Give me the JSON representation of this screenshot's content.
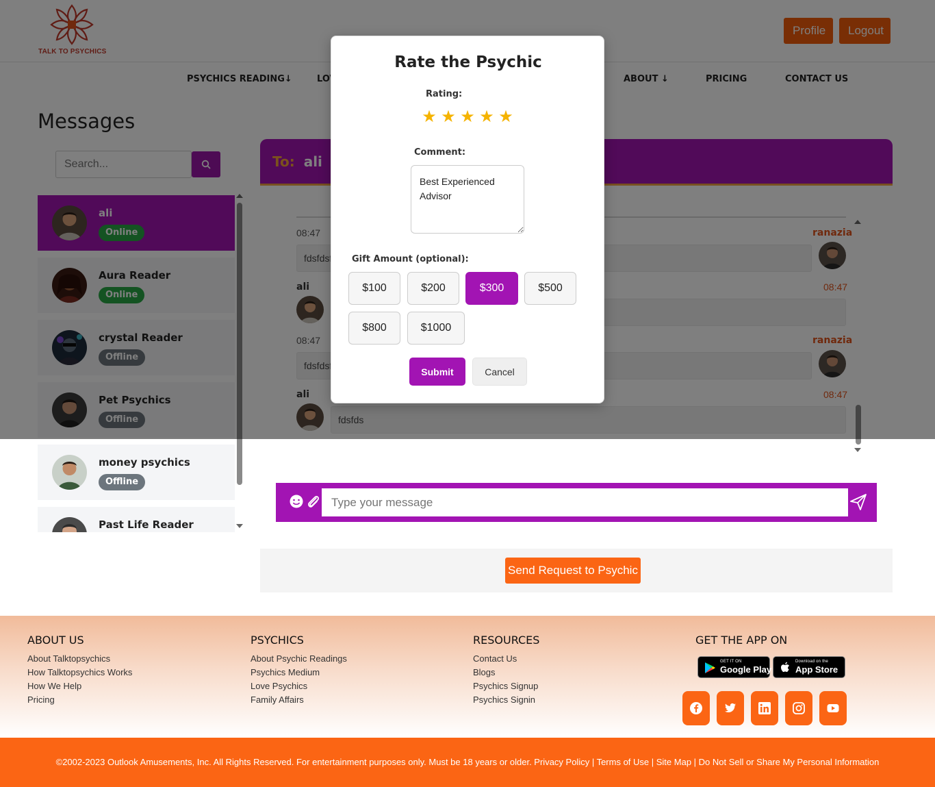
{
  "header": {
    "logo_text": "TALK TO PSYCHICS",
    "profile_label": "Profile",
    "logout_label": "Logout"
  },
  "nav": {
    "psychics_reading": "PSYCHICS READING↓",
    "love": "LOV",
    "about": "ABOUT ↓",
    "pricing": "PRICING",
    "contact": "CONTACT US"
  },
  "page": {
    "title": "Messages"
  },
  "search": {
    "placeholder": "Search..."
  },
  "contacts": [
    {
      "name": "ali",
      "status": "Online"
    },
    {
      "name": "Aura Reader",
      "status": "Online"
    },
    {
      "name": "crystal Reader",
      "status": "Offline"
    },
    {
      "name": "Pet Psychics",
      "status": "Offline"
    },
    {
      "name": "money psychics",
      "status": "Offline"
    },
    {
      "name": "Past Life Reader",
      "status": ""
    }
  ],
  "chat": {
    "to_label": "To:",
    "to_name": "ali",
    "messages": [
      {
        "time": "08:47",
        "sender": "ranazia",
        "text": "fdsfdsf"
      },
      {
        "time": "08:47",
        "sender": "ali",
        "text": ""
      },
      {
        "time": "08:47",
        "sender": "ranazia",
        "text": "fdsfdsf"
      },
      {
        "time": "08:47",
        "sender": "ali",
        "text": "fdsfds"
      }
    ],
    "compose_placeholder": "Type your message",
    "request_label": "Send Request to Psychic"
  },
  "modal": {
    "title": "Rate the Psychic",
    "rating_label": "Rating:",
    "rating_value": 5,
    "star_glyph": "★",
    "comment_label": "Comment:",
    "comment_value": "Best Experienced Advisor",
    "gift_label": "Gift Amount (optional):",
    "gift_options": [
      "$100",
      "$200",
      "$300",
      "$500",
      "$800",
      "$1000"
    ],
    "gift_selected": "$300",
    "submit_label": "Submit",
    "cancel_label": "Cancel"
  },
  "footer": {
    "about": {
      "heading": "ABOUT US",
      "links": [
        "About Talktopsychics",
        "How Talktopsychics Works",
        "How We Help",
        "Pricing"
      ]
    },
    "psychics": {
      "heading": "PSYCHICS",
      "links": [
        "About Psychic Readings",
        "Psychics Medium",
        "Love Psychics",
        "Family Affairs"
      ]
    },
    "resources": {
      "heading": "RESOURCES",
      "links": [
        "Contact Us",
        "Blogs",
        "Psychics Signup",
        "Psychics Signin"
      ]
    },
    "app": {
      "heading": "GET THE APP ON",
      "google_small": "GET IT ON",
      "google_large": "Google Play",
      "apple_small": "Download on the",
      "apple_large": "App Store"
    },
    "social_icons": [
      "facebook-icon",
      "twitter-icon",
      "linkedin-icon",
      "instagram-icon",
      "youtube-icon"
    ],
    "copyright": "©2002-2023 Outlook Amusements, Inc. All Rights Reserved. For entertainment purposes only. Must be 18 years or older. Privacy Policy | Terms of Use | Site Map | Do Not Sell or Share My Personal Information"
  },
  "colors": {
    "purple": "#a214b3",
    "orange": "#fb6514",
    "star": "#f5b301",
    "online": "#28a745",
    "offline": "#6c757d"
  }
}
